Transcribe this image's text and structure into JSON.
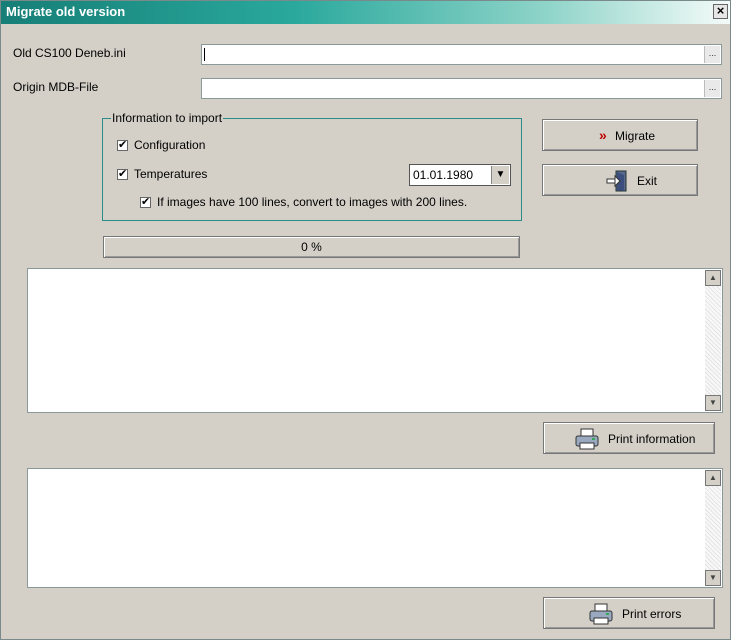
{
  "window": {
    "title": "Migrate old version",
    "close_label": "×"
  },
  "fields": {
    "old_ini": {
      "label": "Old CS100 Deneb.ini",
      "value": "",
      "browse": "..."
    },
    "origin_mdb": {
      "label": "Origin MDB-File",
      "value": "",
      "browse": "..."
    }
  },
  "import_group": {
    "title": "Information to import",
    "configuration": {
      "label": "Configuration",
      "checked": true,
      "mark": "✔"
    },
    "temperatures": {
      "label": "Temperatures",
      "checked": true,
      "mark": "✔"
    },
    "convert_images": {
      "label": "If images have 100 lines, convert to images with 200 lines.",
      "checked": true,
      "mark": "✔"
    },
    "date": {
      "value": "01.01.1980",
      "arrow": "▼"
    }
  },
  "progress": {
    "text": "0 %",
    "value": 0
  },
  "buttons": {
    "migrate": {
      "label": "Migrate",
      "icon": "double-chevron-right-icon",
      "icon_glyph": "»",
      "icon_color": "#c00000"
    },
    "exit": {
      "label": "Exit",
      "icon": "exit-door-icon"
    },
    "print_information": {
      "label": "Print information",
      "icon": "printer-icon"
    },
    "print_errors": {
      "label": "Print errors",
      "icon": "printer-icon"
    }
  },
  "memos": {
    "information": {
      "text": ""
    },
    "errors": {
      "text": ""
    }
  },
  "scroll": {
    "up": "▲",
    "down": "▼"
  },
  "colors": {
    "title_start": "#167f77",
    "title_end": "#f4fbf9",
    "frame": "#2a8c88"
  }
}
